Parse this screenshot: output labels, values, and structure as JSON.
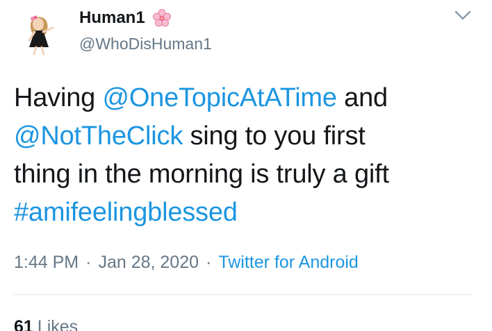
{
  "user": {
    "display_name": "Human1",
    "handle": "@WhoDisHuman1",
    "avatar_icon": "cartoon-girl-avatar",
    "name_emoji_icon": "cherry-blossom-icon"
  },
  "tweet": {
    "line1_prefix": "Having ",
    "mention1": "@OneTopicAtATime",
    "line1_suffix": " and",
    "mention2": "@NotTheClick",
    "line2_suffix": " sing to you first",
    "line3": "thing in the morning is truly a gift",
    "hashtag": "#amifeelingblessed"
  },
  "meta": {
    "time": "1:44 PM",
    "separator": "·",
    "date": "Jan 28, 2020",
    "source": "Twitter for Android"
  },
  "stats": {
    "likes_count": "61",
    "likes_label": "Likes"
  },
  "colors": {
    "link": "#1b95e0",
    "secondary_text": "#657786",
    "divider": "#e1e8ed"
  }
}
